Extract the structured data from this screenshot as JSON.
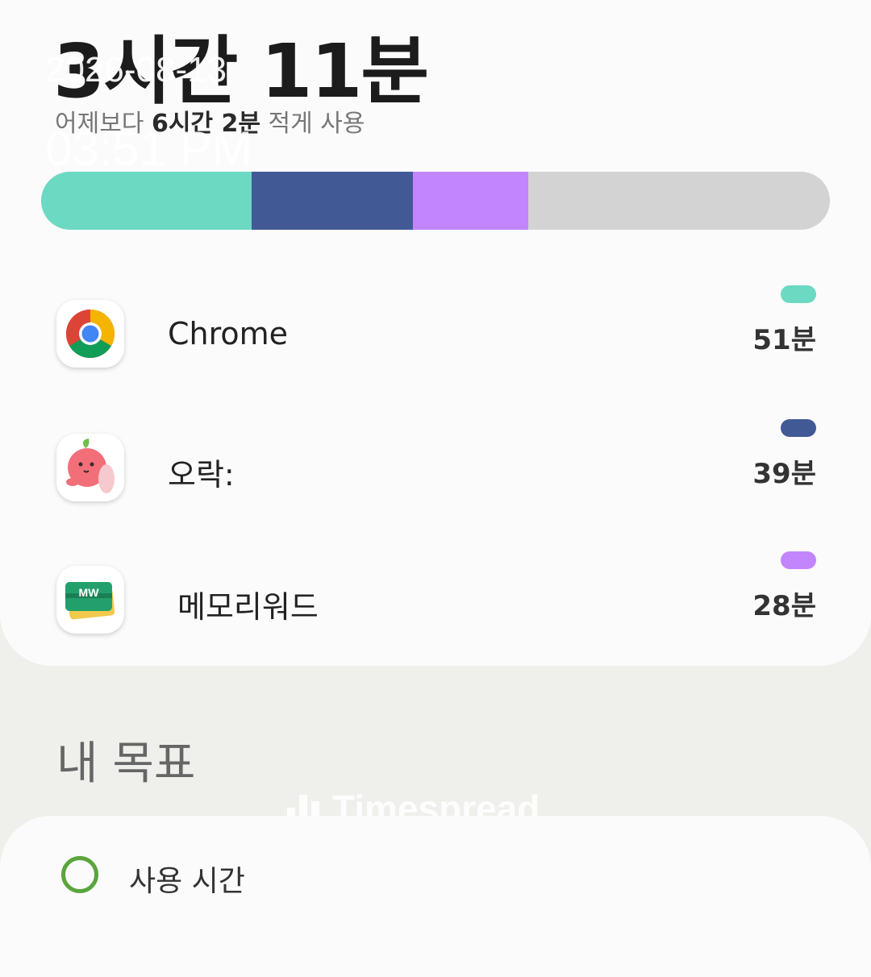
{
  "overlay": {
    "date": "2026-08-13",
    "time": "03:51 PM"
  },
  "summary": {
    "total_time": "3시간 11분",
    "compare_prefix": "어제보다",
    "compare_amount": "6시간 2분",
    "compare_suffix": "적게 사용"
  },
  "usage_bar": {
    "track_color": "#d3d3d3",
    "segments": [
      {
        "app": "Chrome",
        "minutes": 51,
        "color": "#6cd9c3"
      },
      {
        "app": "오락:",
        "minutes": 39,
        "color": "#415a96"
      },
      {
        "app": "메모리워드",
        "minutes": 28,
        "color": "#c385fc"
      }
    ]
  },
  "apps": [
    {
      "name": "Chrome",
      "time": "51분",
      "color": "#6cd9c3",
      "icon": "chrome-icon"
    },
    {
      "name": "오락:",
      "time": "39분",
      "color": "#415a96",
      "icon": "peach-character-icon"
    },
    {
      "name": "메모리워드",
      "time": "28분",
      "color": "#c385fc",
      "icon": "memoryword-card-icon"
    }
  ],
  "goals": {
    "title": "내 목표",
    "item_label": "사용 시간",
    "item_icon": "timer-icon",
    "icon_color": "#5aa53c"
  },
  "watermark": {
    "text": "Timespread"
  }
}
